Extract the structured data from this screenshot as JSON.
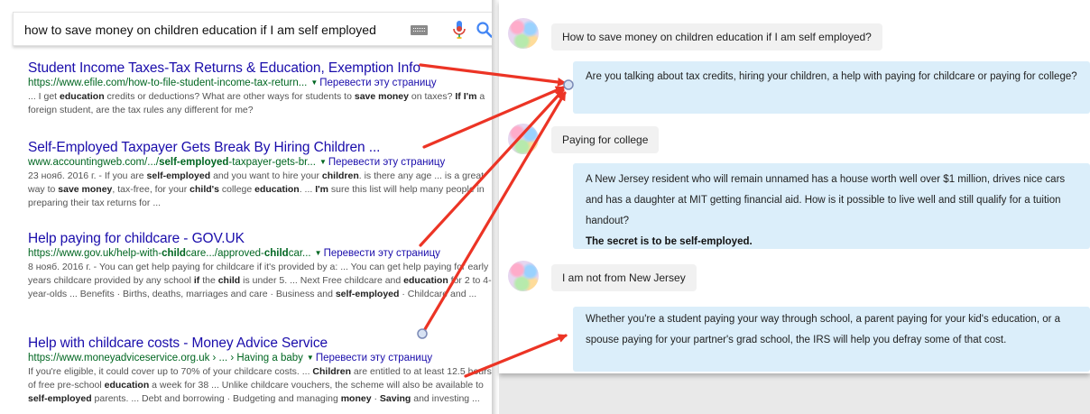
{
  "search": {
    "query": "how to save money on children education if I am self employed"
  },
  "results": [
    {
      "title": "Student Income Taxes-Tax Returns & Education, Exemption Info",
      "url": "https://www.efile.com/how-to-file-student-income-tax-return...",
      "translate": "Перевести эту страницу",
      "snippet_html": "... I get <b>education</b> credits or deductions? What are other ways for students to <b>save money</b> on taxes? <b>If I'm</b> a foreign student, are the tax rules any different for me?"
    },
    {
      "title": "Self-Employed Taxpayer Gets Break By Hiring Children ...",
      "url_html": "www.accountingweb.com/.../<b>self-employed</b>-taxpayer-gets-br...",
      "translate": "Перевести эту страницу",
      "snippet_html": "23 нояб. 2016 г. - If you are <b>self-employed</b> and you want to hire your <b>children</b>. is there any age ... is a great way to <b>save money</b>, tax-free, for your <b>child's</b> college <b>education</b>. ... <b>I'm</b> sure this list will help many people in preparing their tax returns for ..."
    },
    {
      "title": "Help paying for childcare - GOV.UK",
      "url_html": "https://www.gov.uk/help-with-<b>child</b>care.../approved-<b>child</b>car...",
      "translate": "Перевести эту страницу",
      "snippet_html": "8 нояб. 2016 г. - You can get help paying for childcare if it's provided by a: ... You can get help paying for early years childcare provided by any school <b>if</b> the <b>child</b> is under 5. ... Next Free childcare and <b>education</b> for 2 to 4-year-olds ... Benefits · Births, deaths, marriages and care · Business and <b>self-employed</b> · Childcare and ..."
    },
    {
      "title": "Help with childcare costs - Money Advice Service",
      "url": "https://www.moneyadviceservice.org.uk › ... › Having a baby",
      "translate": "Перевести эту страницу",
      "snippet_html": "If you're eligible, it could cover up to 70% of your childcare costs. ... <b>Children</b> are entitled to at least 12.5 hours of free pre-school <b>education</b> a week for 38 ... Unlike childcare vouchers, the scheme will also be available to <b>self-employed</b> parents. ... Debt and borrowing · Budgeting and managing <b>money</b> · <b>Saving</b> and investing ..."
    }
  ],
  "chat": {
    "user_1": "How to save money on children education if I am self employed?",
    "bot_1": "Are you talking about tax credits, hiring your children, a help with paying for childcare or paying for college?",
    "user_2": "Paying for college",
    "bot_2": "A New Jersey resident who will remain unnamed has a house worth well over $1 million, drives nice cars and has a daughter at MIT getting financial aid. How is it possible to live well and still qualify for a tuition handout?",
    "bot_2_bold": "The secret is to be self-employed.",
    "user_3": "I am not from New Jersey",
    "bot_3": "Whether you're a student paying your way through school, a parent paying for your kid's education, or a spouse paying for your partner's grad school, the IRS will help you defray some of that cost."
  },
  "colors": {
    "link": "#1a0dab",
    "url": "#006621",
    "user_bubble": "#f1f1f1",
    "bot_bubble": "#dbeefa",
    "arrow": "#ec3425",
    "mic_red": "#db4437",
    "mic_blue": "#4285f4"
  }
}
